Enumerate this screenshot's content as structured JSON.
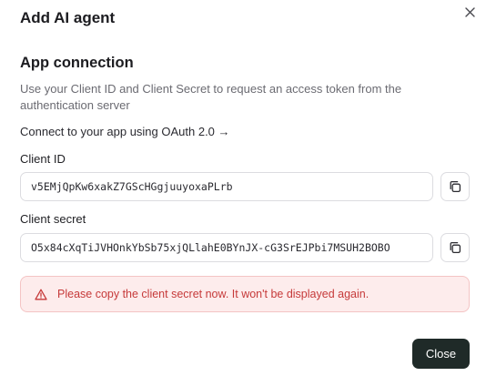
{
  "dialog": {
    "title": "Add AI agent",
    "close_icon": "close-icon"
  },
  "app_connection": {
    "heading": "App connection",
    "description": "Use your Client ID and Client Secret to request an access token from the authentication server",
    "oauth_link": "Connect to your app using OAuth 2.0 →"
  },
  "client_id": {
    "label": "Client ID",
    "value": "v5EMjQpKw6xakZ7GScHGgjuuyoxaPLrb",
    "copy_icon": "copy-icon"
  },
  "client_secret": {
    "label": "Client secret",
    "value": "O5x84cXqTiJVHOnkYbSb75xjQLlahE0BYnJX-cG3SrEJPbi7MSUH2BOBO",
    "copy_icon": "copy-icon"
  },
  "alert": {
    "icon": "warning-icon",
    "message": "Please copy the client secret now. It won't be displayed again."
  },
  "footer": {
    "close_label": "Close"
  },
  "colors": {
    "alert_background": "#fdecec",
    "alert_border": "#f4c4c4",
    "alert_text": "#c63a3a",
    "primary_button": "#1f2a28"
  }
}
